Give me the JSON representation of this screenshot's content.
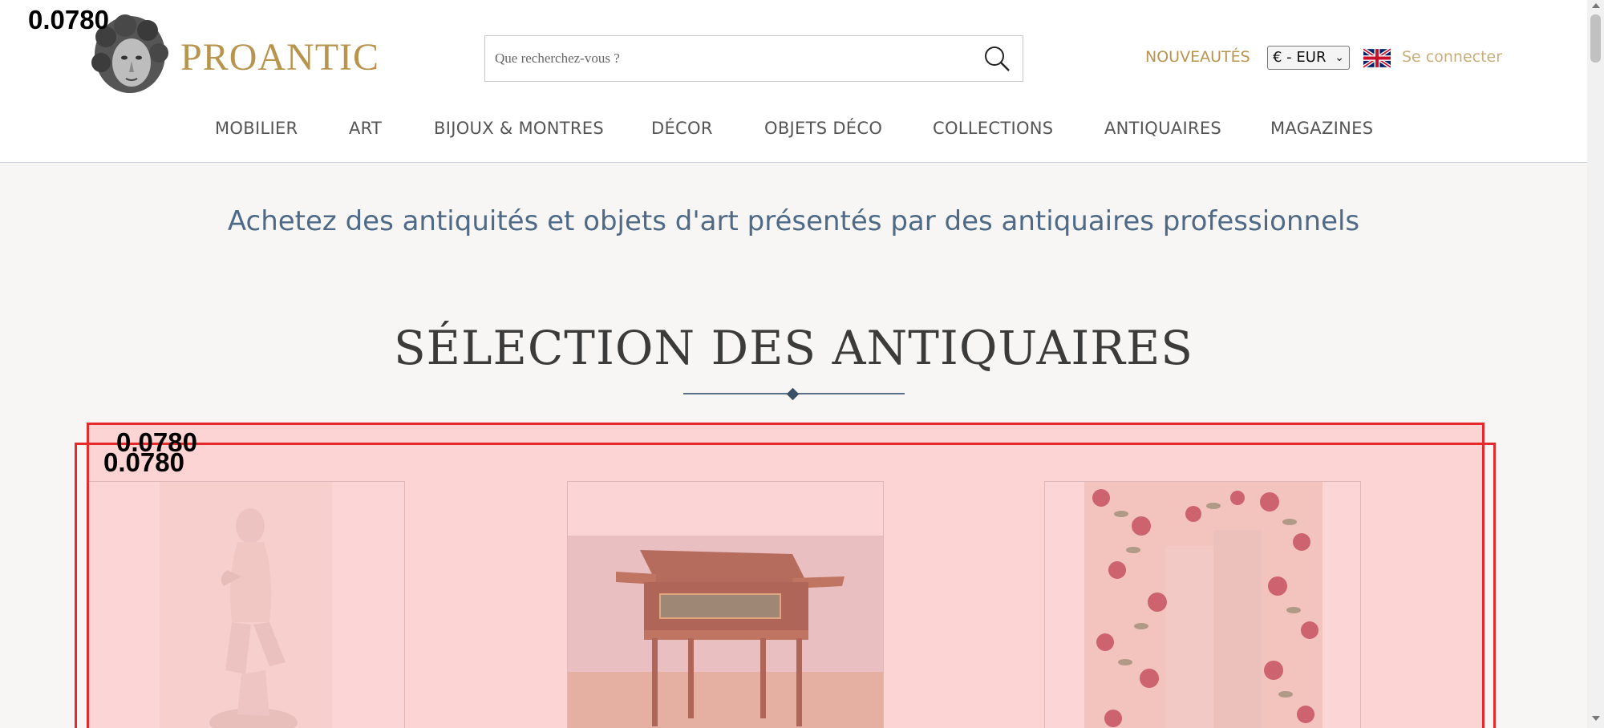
{
  "header": {
    "logo_text": "PROANTIC",
    "search": {
      "placeholder": "Que recherchez-vous ?"
    },
    "nouveautes": "NOUVEAUTÉS",
    "currency": "€ - EUR",
    "login": "Se connecter",
    "nav": [
      "MOBILIER",
      "ART",
      "BIJOUX & MONTRES",
      "DÉCOR",
      "OBJETS DÉCO",
      "COLLECTIONS",
      "ANTIQUAIRES",
      "MAGAZINES"
    ]
  },
  "main": {
    "tagline": "Achetez des antiquités et objets d'art présentés par des antiquaires professionnels",
    "section_title": "SÉLECTION DES ANTIQUAIRES"
  },
  "overlay": {
    "scores": [
      "0.0780",
      "0.0780",
      "0.0780"
    ],
    "box_color": "#e42a2a"
  },
  "colors": {
    "gold": "#b8944f",
    "blue": "#4e6a87"
  }
}
